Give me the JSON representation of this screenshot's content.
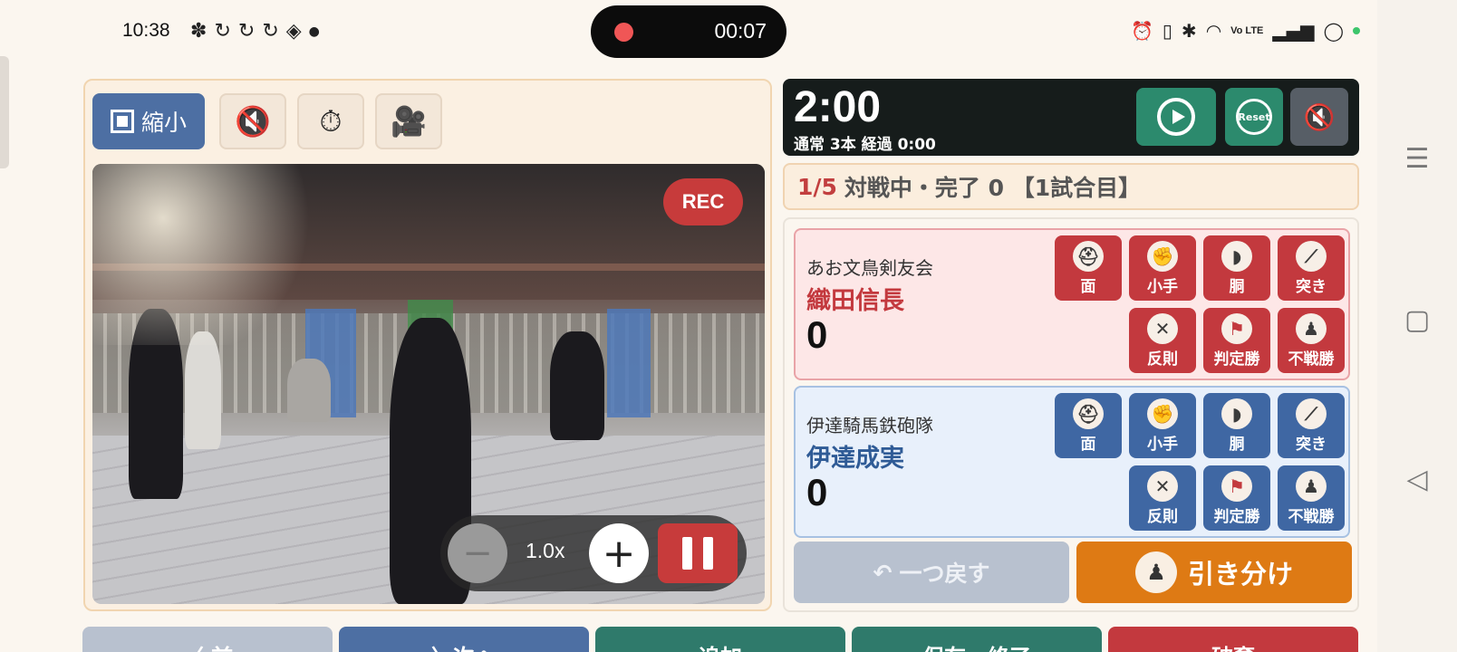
{
  "status_bar": {
    "clock": "10:38",
    "notif_icons": [
      "slack-icon",
      "sync-icon",
      "sync-icon",
      "sync-icon",
      "sheets-icon",
      "dot-icon"
    ],
    "recording_time": "00:07",
    "volte": "Vo LTE"
  },
  "video_panel": {
    "shrink_label": "縮小",
    "rec_label": "REC",
    "zoom_level": "1.0x"
  },
  "timer": {
    "time": "2:00",
    "sub": "通常 3本 経過 0:00",
    "reset_label": "Reset"
  },
  "match_status": {
    "index": "1/5",
    "text": "対戦中・完了 0 【1試合目】"
  },
  "red_player": {
    "team": "あお文鳥剣友会",
    "name": "織田信長",
    "score": "0"
  },
  "white_player": {
    "team": "伊達騎馬鉄砲隊",
    "name": "伊達成実",
    "score": "0"
  },
  "waza": {
    "men": "面",
    "kote": "小手",
    "do": "胴",
    "tsuki": "突き",
    "hansoku": "反則",
    "hantei": "判定勝",
    "fusen": "不戦勝"
  },
  "actions": {
    "undo": "一つ戻す",
    "draw": "引き分け"
  },
  "bottom": {
    "prev": "〈 前",
    "next": "〉次へ",
    "add": "追加",
    "save_end": "保存・終了",
    "discard": "破棄"
  },
  "colors": {
    "red": "#c3393e",
    "blue": "#3f67a3",
    "green": "#2c8a6d",
    "orange": "#de7a14"
  }
}
